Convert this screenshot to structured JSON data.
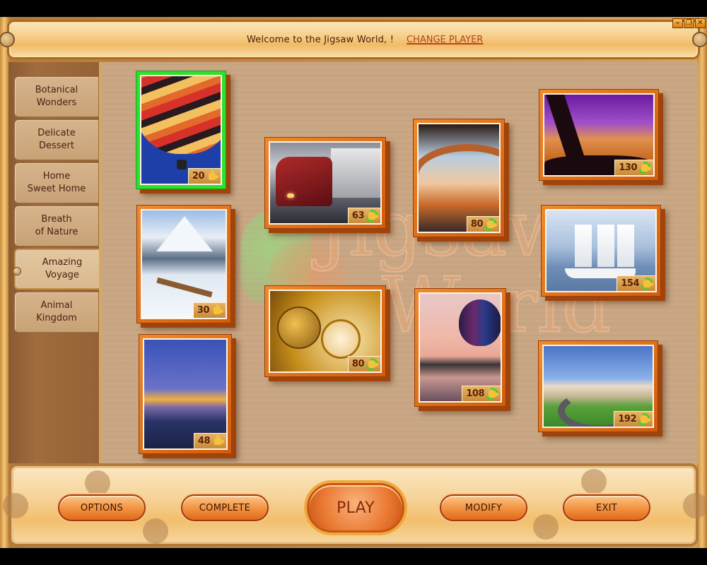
{
  "header": {
    "welcome_text": "Welcome to the Jigsaw World, !",
    "change_player_label": "CHANGE PLAYER"
  },
  "window_controls": {
    "minimize": "–",
    "restore": "❐",
    "close": "✕"
  },
  "sidebar": {
    "items": [
      {
        "label": "Botanical\nWonders",
        "active": false
      },
      {
        "label": "Delicate\nDessert",
        "active": false
      },
      {
        "label": "Home\nSweet Home",
        "active": false
      },
      {
        "label": "Breath\nof Nature",
        "active": false
      },
      {
        "label": "Amazing\nVoyage",
        "active": true
      },
      {
        "label": "Animal\nKingdom",
        "active": false
      }
    ]
  },
  "watermark": {
    "line1": "Jigsaw",
    "line2": "World"
  },
  "puzzles": [
    {
      "subject": "hot air balloon",
      "pieces": "20",
      "icon": "puzzle-piece-icon",
      "selected": true
    },
    {
      "subject": "winter train in mountains",
      "pieces": "30",
      "icon": "puzzle-piece-icon",
      "selected": false
    },
    {
      "subject": "sunset highway",
      "pieces": "48",
      "icon": "puzzle-piece-icon",
      "selected": false
    },
    {
      "subject": "red semi truck",
      "pieces": "63",
      "icon": "rotate-puzzle-icon",
      "selected": false
    },
    {
      "subject": "antique compass on map",
      "pieces": "80",
      "icon": "rotate-puzzle-icon",
      "selected": false
    },
    {
      "subject": "highway overpass",
      "pieces": "80",
      "icon": "rotate-puzzle-icon",
      "selected": false
    },
    {
      "subject": "balloon over lake at dusk",
      "pieces": "108",
      "icon": "rotate-puzzle-icon",
      "selected": false
    },
    {
      "subject": "desert drive",
      "pieces": "130",
      "icon": "rotate-puzzle-icon",
      "selected": false
    },
    {
      "subject": "tall ship",
      "pieces": "154",
      "icon": "rotate-puzzle-icon",
      "selected": false
    },
    {
      "subject": "badlands road",
      "pieces": "192",
      "icon": "rotate-puzzle-icon",
      "selected": false
    }
  ],
  "footer": {
    "options_label": "OPTIONS",
    "complete_label": "COMPLETE",
    "play_label": "PLAY",
    "modify_label": "MODIFY",
    "exit_label": "EXIT"
  }
}
